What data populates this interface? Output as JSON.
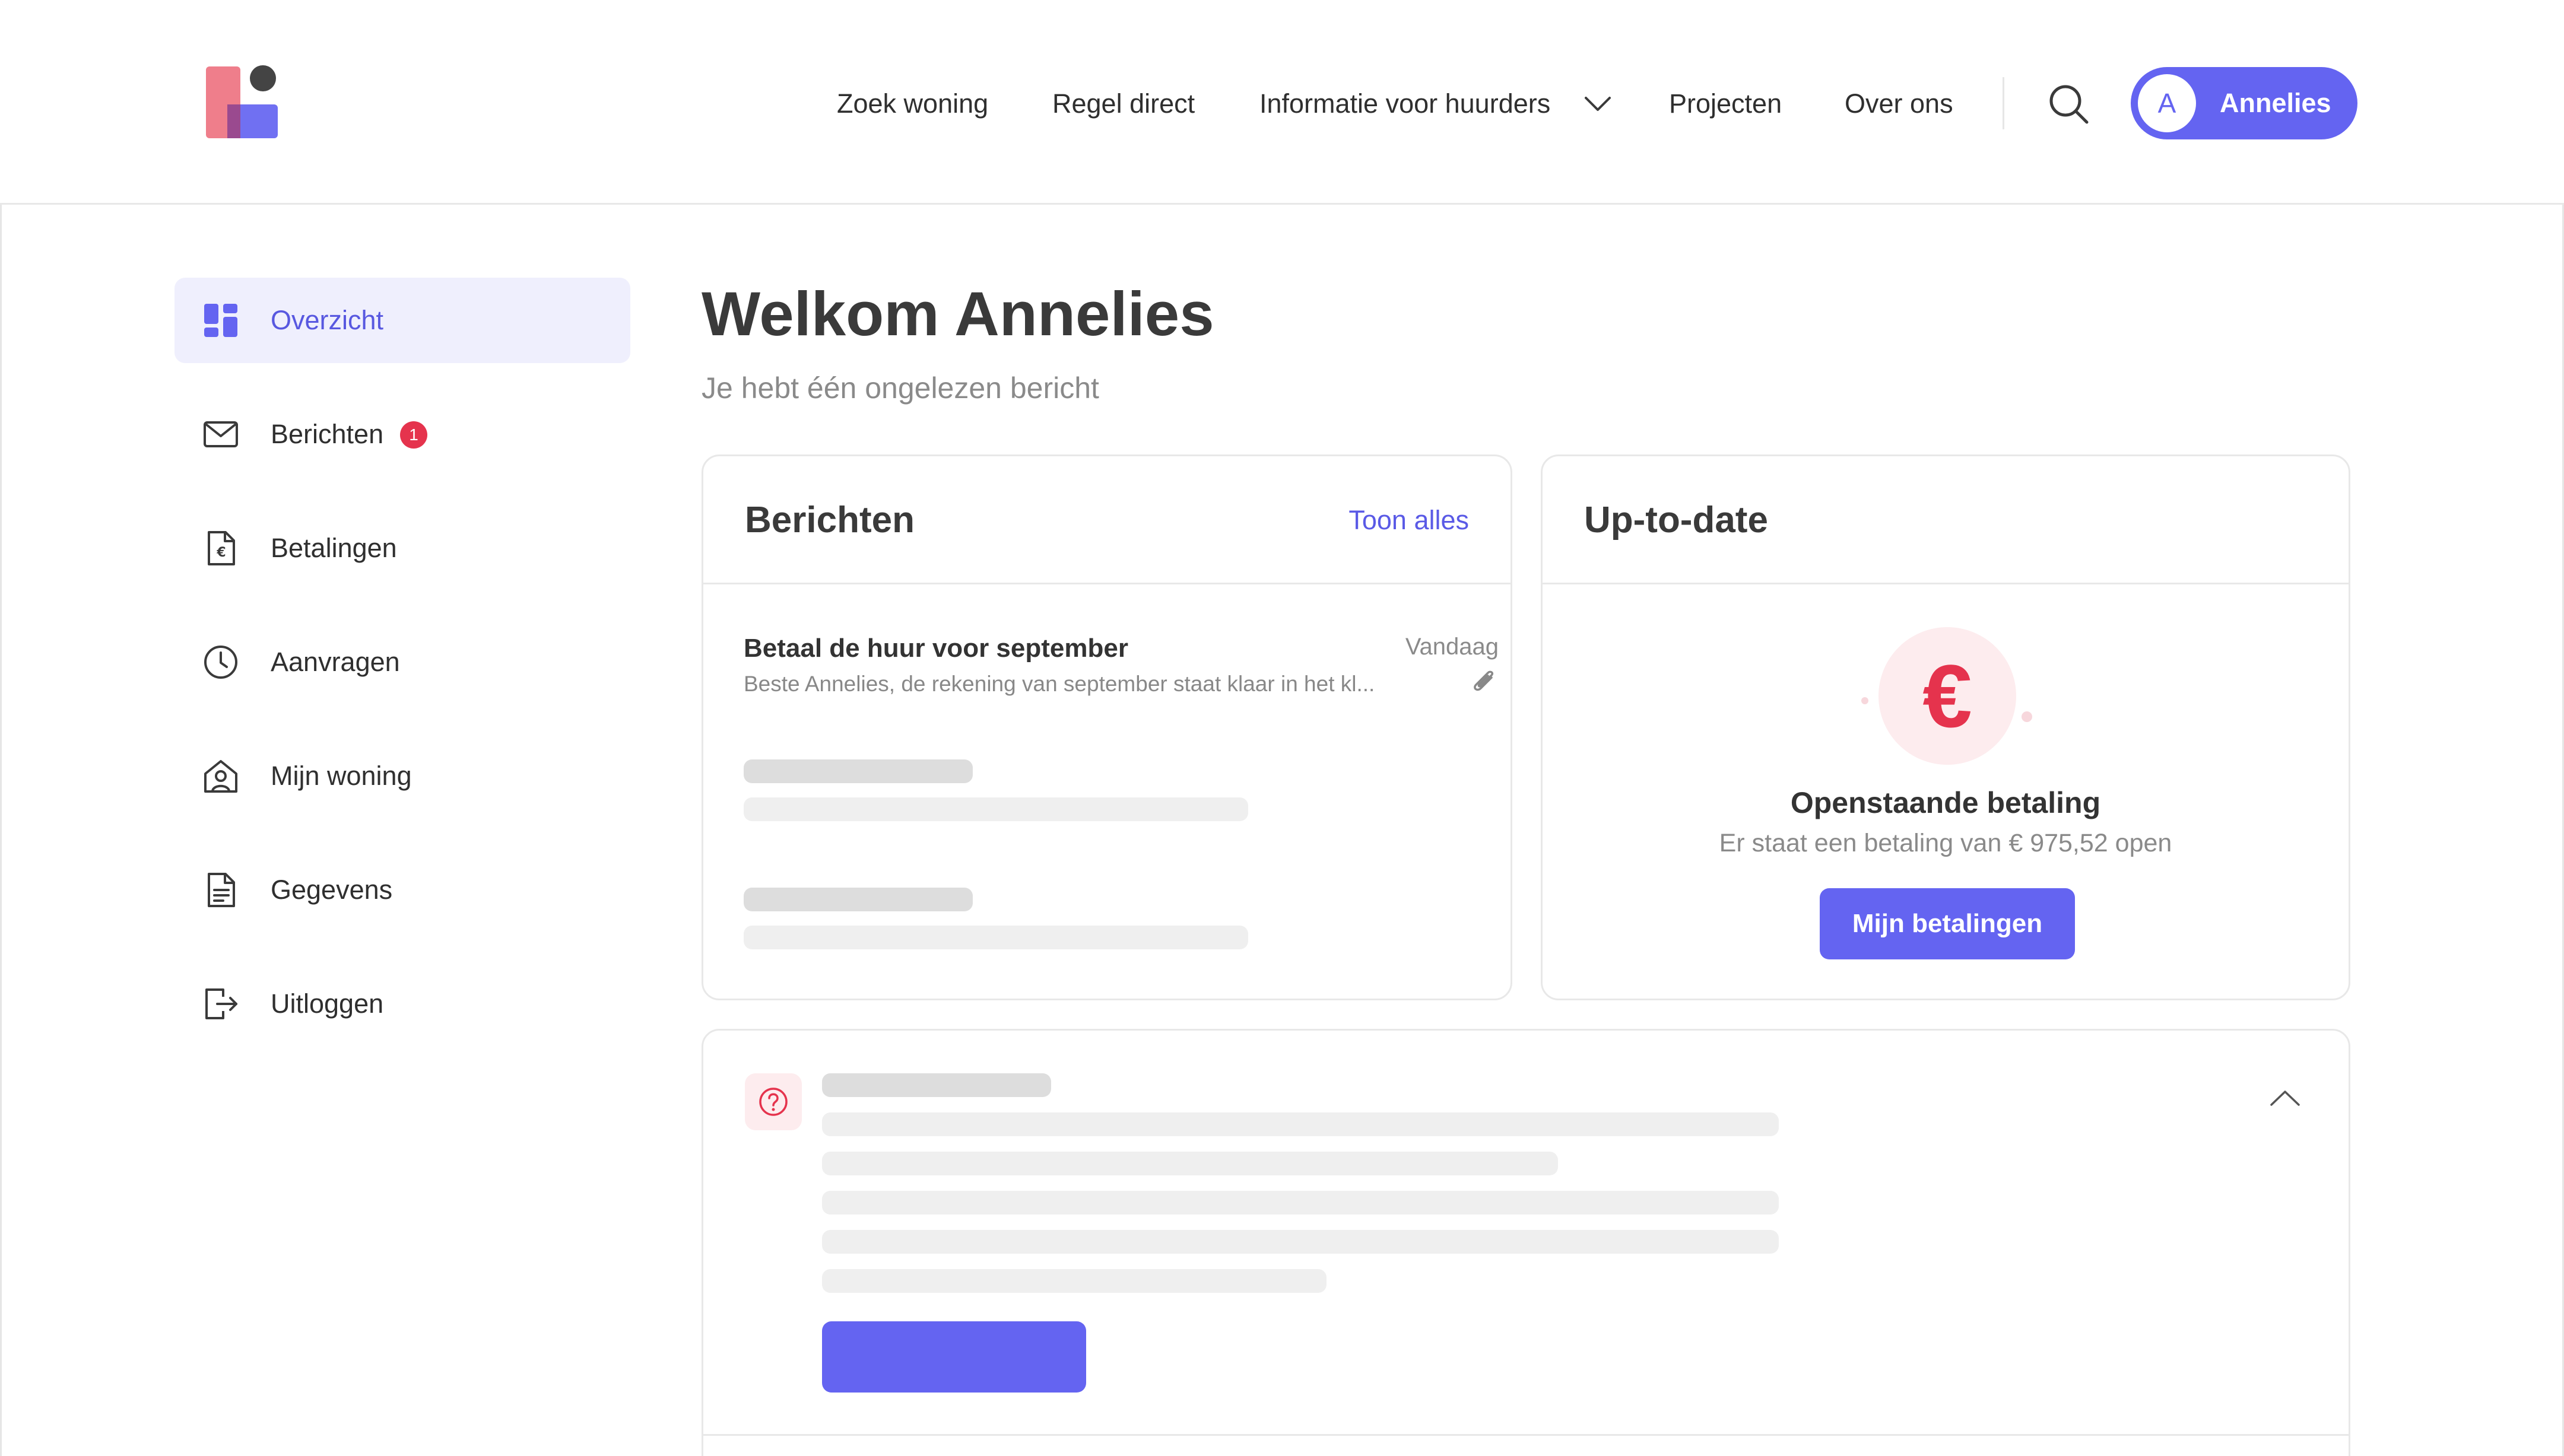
{
  "brand": {
    "accent": "#6464f1",
    "alert": "#e5334d",
    "logo": "logo-mark"
  },
  "header": {
    "nav": [
      {
        "label": "Zoek woning"
      },
      {
        "label": "Regel direct"
      },
      {
        "label": "Informatie voor huurders",
        "has_dropdown": true
      },
      {
        "label": "Projecten"
      },
      {
        "label": "Over ons"
      }
    ],
    "search_icon": "search-icon",
    "user": {
      "initial": "A",
      "name": "Annelies"
    }
  },
  "sidebar": {
    "items": [
      {
        "label": "Overzicht",
        "icon": "dashboard-icon",
        "active": true
      },
      {
        "label": "Berichten",
        "icon": "mail-icon",
        "badge": "1"
      },
      {
        "label": "Betalingen",
        "icon": "euro-document-icon"
      },
      {
        "label": "Aanvragen",
        "icon": "clock-icon"
      },
      {
        "label": "Mijn woning",
        "icon": "home-user-icon"
      },
      {
        "label": "Gegevens",
        "icon": "document-icon"
      },
      {
        "label": "Uitloggen",
        "icon": "logout-icon"
      }
    ]
  },
  "main": {
    "title": "Welkom Annelies",
    "subtitle": "Je hebt één ongelezen bericht",
    "messages_card": {
      "title": "Berichten",
      "link": "Toon alles",
      "message": {
        "title": "Betaal de huur voor september",
        "date": "Vandaag",
        "preview": "Beste Annelies, de rekening van september staat klaar in het kl...",
        "attachment_icon": "paperclip-icon"
      }
    },
    "status_card": {
      "title": "Up-to-date",
      "icon": "euro-icon",
      "icon_glyph": "€",
      "status_title": "Openstaande betaling",
      "status_text": "Er staat een betaling van € 975,52 open",
      "button": "Mijn betalingen"
    },
    "info_card": {
      "icon": "help-icon",
      "toggle_icon": "chevron-up-icon"
    }
  }
}
